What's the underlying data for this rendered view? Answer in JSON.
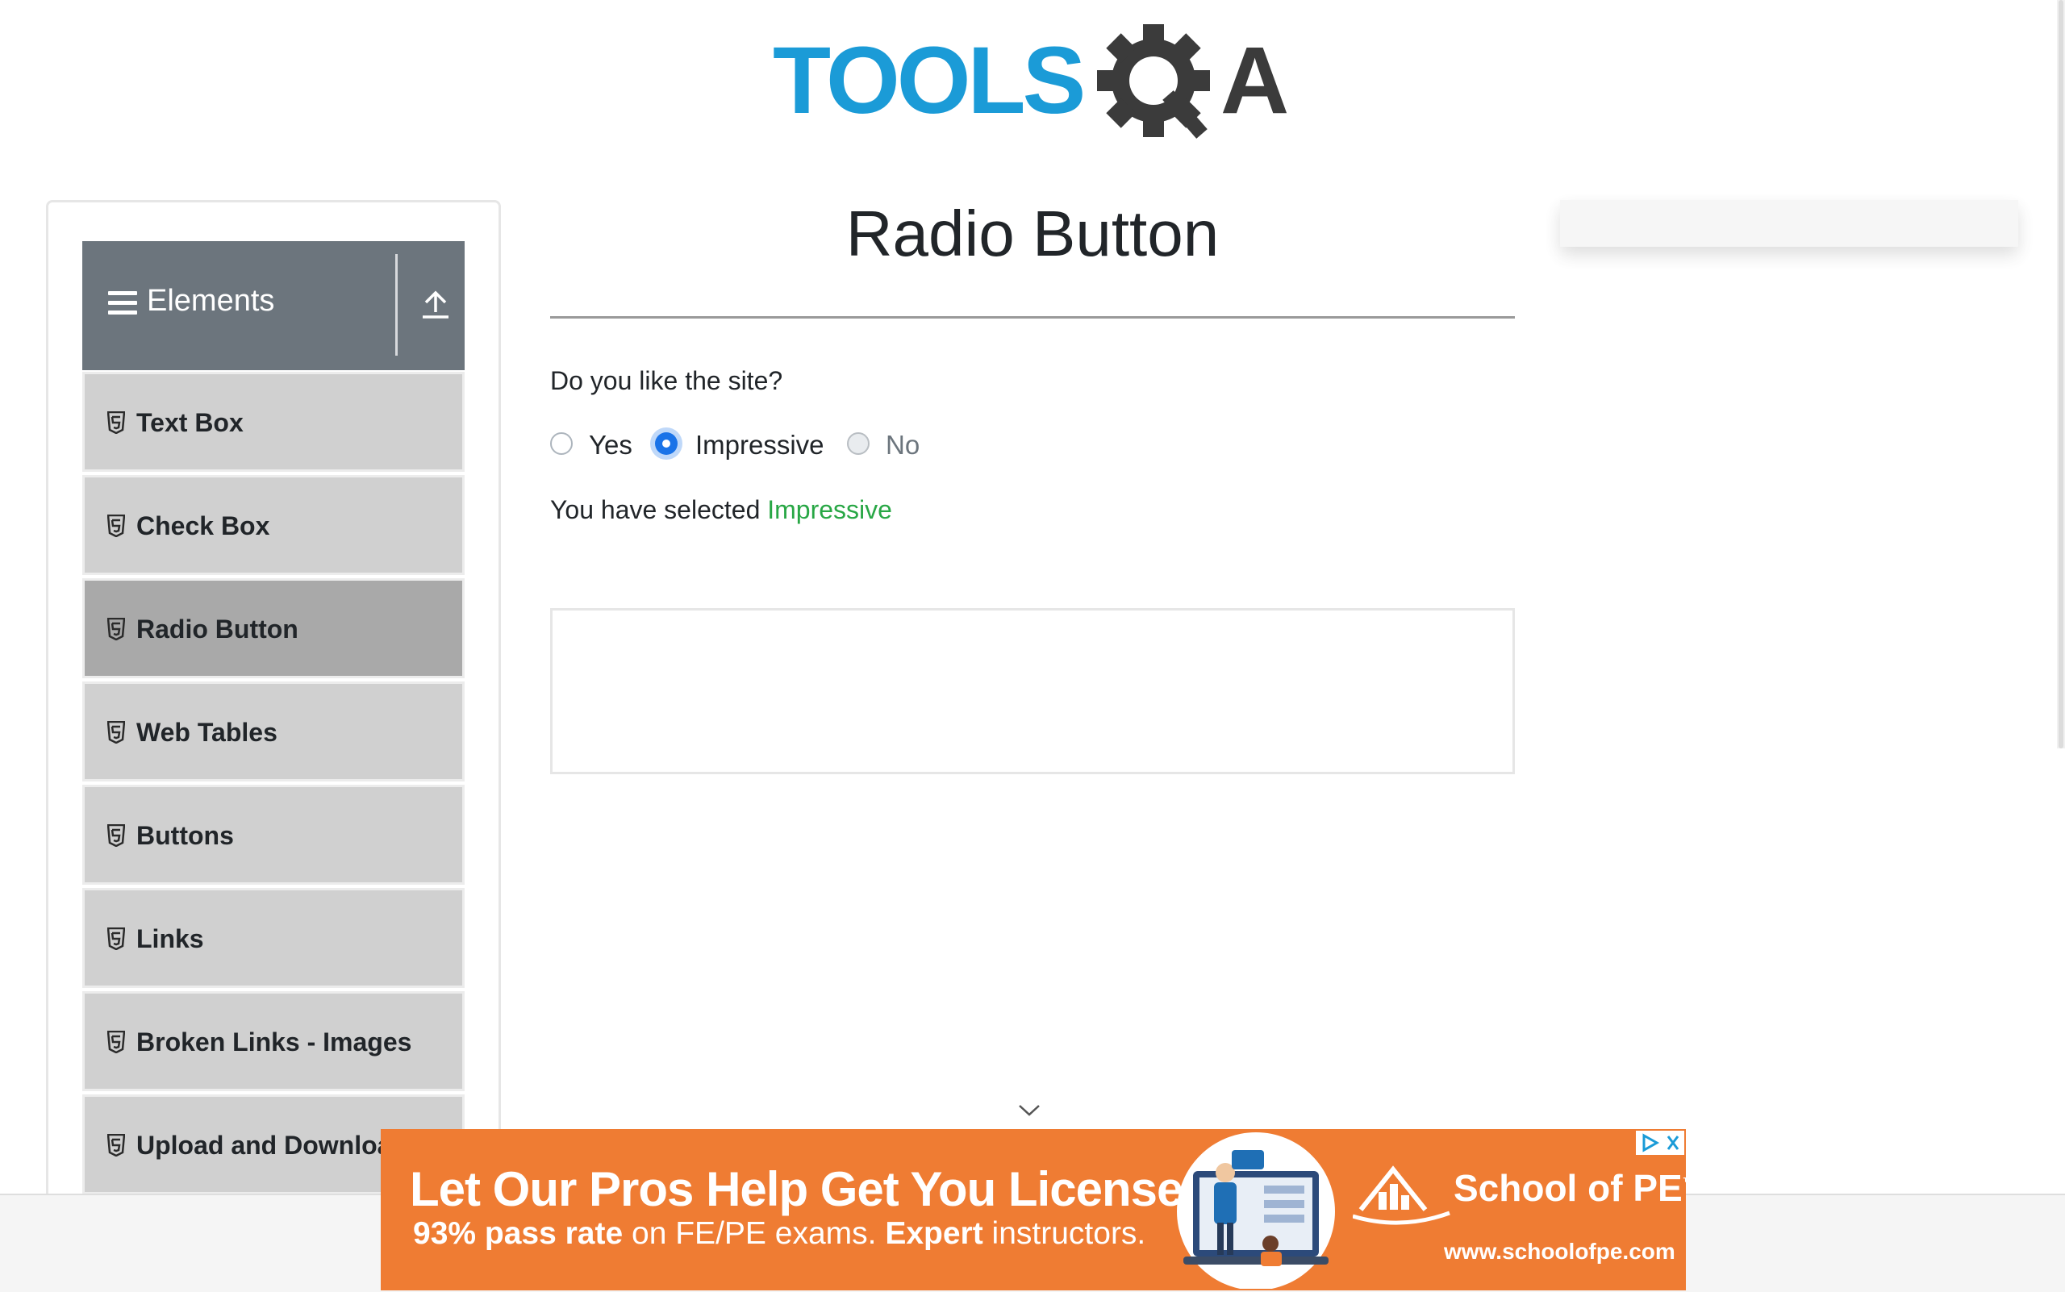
{
  "header": {
    "logo_text": "TOOLSQA",
    "colors": {
      "tools": "#1b9bd7",
      "qa": "#3b3b3b"
    }
  },
  "sidebar": {
    "group": {
      "label": "Elements",
      "icon": "hamburger-icon",
      "toggle_icon": "collapse-up-icon"
    },
    "items": [
      {
        "label": "Text Box",
        "active": false
      },
      {
        "label": "Check Box",
        "active": false
      },
      {
        "label": "Radio Button",
        "active": true
      },
      {
        "label": "Web Tables",
        "active": false
      },
      {
        "label": "Buttons",
        "active": false
      },
      {
        "label": "Links",
        "active": false
      },
      {
        "label": "Broken Links - Images",
        "active": false
      },
      {
        "label": "Upload and Download",
        "active": false
      }
    ]
  },
  "main": {
    "title": "Radio Button",
    "question": "Do you like the site?",
    "options": [
      {
        "label": "Yes",
        "checked": false,
        "disabled": false
      },
      {
        "label": "Impressive",
        "checked": true,
        "disabled": false
      },
      {
        "label": "No",
        "checked": false,
        "disabled": true
      }
    ],
    "result_prefix": "You have selected",
    "result_value": "Impressive",
    "colors": {
      "accent": "#1a73e8",
      "success": "#28a745"
    }
  },
  "ad_banner": {
    "headline": "Let Our Pros Help Get You Licensed",
    "sub_parts": [
      "93% pass rate",
      "on FE/PE exams.",
      "Expert",
      "instructors."
    ],
    "brand": "School of PE",
    "trademark": "™",
    "url": "www.schoolofpe.com",
    "background": "#ef7c33"
  }
}
